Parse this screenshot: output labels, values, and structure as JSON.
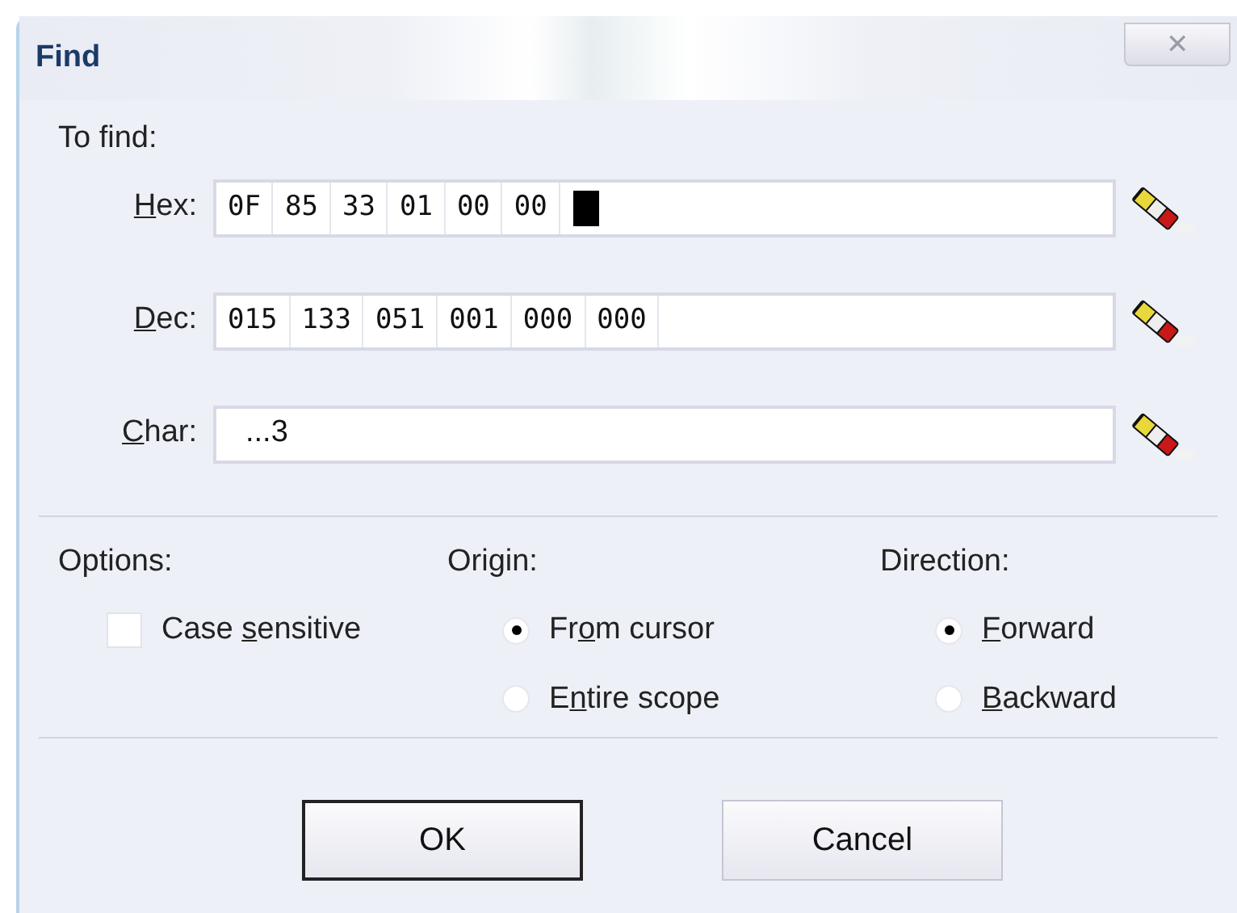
{
  "window": {
    "title": "Find",
    "close": "✕"
  },
  "to_find": {
    "label": "To find:",
    "rows": [
      {
        "kind": "cells",
        "label": {
          "key": "H",
          "after": "ex:"
        },
        "cells": [
          "0F",
          "85",
          "33",
          "01",
          "00",
          "00"
        ],
        "caret": true
      },
      {
        "kind": "cells",
        "label": {
          "key": "D",
          "after": "ec:"
        },
        "cells": [
          "015",
          "133",
          "051",
          "001",
          "000",
          "000"
        ],
        "caret": false
      },
      {
        "kind": "text",
        "label": {
          "key": "C",
          "after": "har:"
        },
        "value": "...3"
      }
    ]
  },
  "options": {
    "label": "Options:",
    "items": [
      {
        "label": {
          "before": "Case ",
          "key": "s",
          "after": "ensitive"
        },
        "checked": false
      }
    ]
  },
  "origin": {
    "label": "Origin:",
    "items": [
      {
        "label": {
          "before": "Fr",
          "key": "o",
          "after": "m cursor"
        },
        "selected": true
      },
      {
        "label": {
          "before": "E",
          "key": "n",
          "after": "tire scope"
        },
        "selected": false
      }
    ]
  },
  "direction": {
    "label": "Direction:",
    "items": [
      {
        "label": {
          "key": "F",
          "after": "orward"
        },
        "selected": true
      },
      {
        "label": {
          "key": "B",
          "after": "ackward"
        },
        "selected": false
      }
    ]
  },
  "buttons": [
    {
      "label": "OK",
      "default": true
    },
    {
      "label": "Cancel",
      "default": false
    }
  ]
}
